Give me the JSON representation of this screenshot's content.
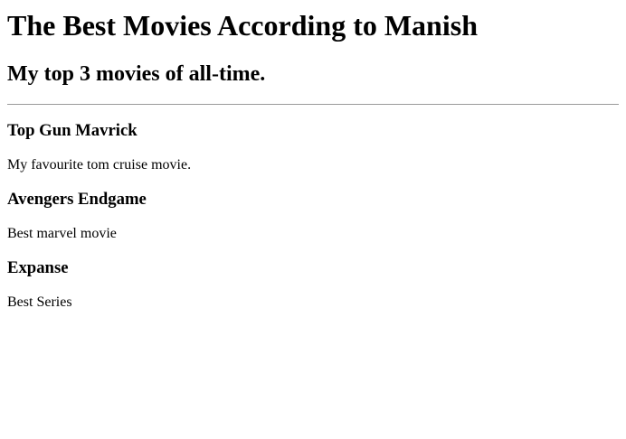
{
  "title": "The Best Movies According to Manish",
  "subtitle": "My top 3 movies of all-time.",
  "movies": [
    {
      "name": "Top Gun Mavrick",
      "desc": "My favourite tom cruise movie."
    },
    {
      "name": "Avengers Endgame",
      "desc": "Best marvel movie"
    },
    {
      "name": "Expanse",
      "desc": "Best Series"
    }
  ]
}
